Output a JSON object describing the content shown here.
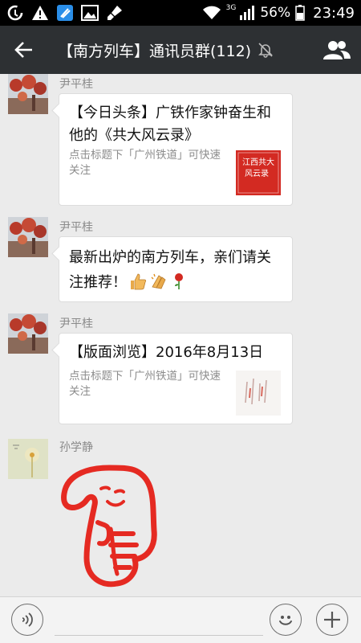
{
  "status_bar": {
    "network": "3G",
    "battery": "56%",
    "time": "23:49"
  },
  "header": {
    "title": "【南方列车】通讯员群(112)"
  },
  "messages": [
    {
      "sender": "尹平桂",
      "type": "link-card",
      "title": "【今日头条】广铁作家钟奋生和他的《共大风云录》",
      "desc": "点击标题下「广州铁道」可快速关注",
      "thumb_text_1": "江西共大",
      "thumb_text_2": "风云录"
    },
    {
      "sender": "尹平桂",
      "type": "text",
      "text": "最新出炉的南方列车，亲们请关注推荐！"
    },
    {
      "sender": "尹平桂",
      "type": "link-card",
      "title": "【版面浏览】2016年8月13日",
      "desc": "点击标题下「广州铁道」可快速关注"
    },
    {
      "sender": "孙学静",
      "type": "image"
    }
  ],
  "colors": {
    "header_bg": "#2d3033",
    "chat_bg": "#ebebeb",
    "sticker_red": "#e52a22"
  }
}
